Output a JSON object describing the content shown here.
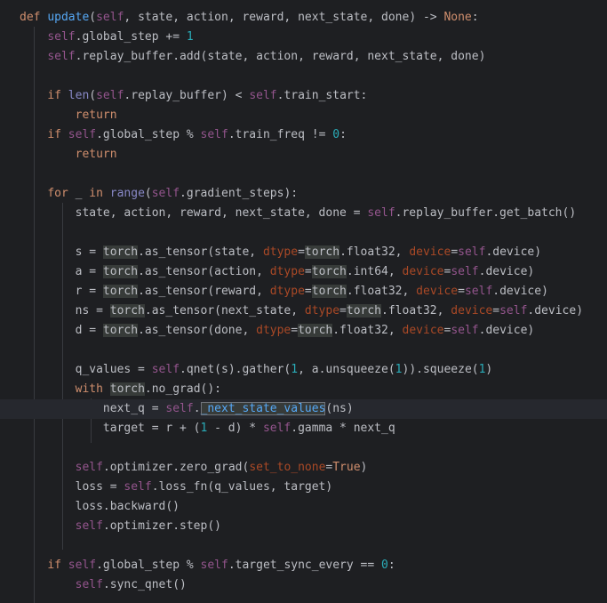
{
  "editor": {
    "language": "python",
    "highlighted_line": 20,
    "lines": [
      [
        [
          "def ",
          "kw"
        ],
        [
          "update",
          "fn"
        ],
        [
          "(",
          "plain"
        ],
        [
          "self",
          "self"
        ],
        [
          ", state, action, reward, next_state, done) -> ",
          "plain"
        ],
        [
          "None",
          "kw"
        ],
        [
          ":",
          "plain"
        ]
      ],
      [
        [
          "    ",
          "plain"
        ],
        [
          "self",
          "self"
        ],
        [
          ".global_step += ",
          "plain"
        ],
        [
          "1",
          "num"
        ]
      ],
      [
        [
          "    ",
          "plain"
        ],
        [
          "self",
          "self"
        ],
        [
          ".replay_buffer.add(state, action, reward, next_state, done)",
          "plain"
        ]
      ],
      [],
      [
        [
          "    ",
          "plain"
        ],
        [
          "if ",
          "kw"
        ],
        [
          "len",
          "builtin"
        ],
        [
          "(",
          "plain"
        ],
        [
          "self",
          "self"
        ],
        [
          ".replay_buffer) < ",
          "plain"
        ],
        [
          "self",
          "self"
        ],
        [
          ".train_start:",
          "plain"
        ]
      ],
      [
        [
          "        ",
          "plain"
        ],
        [
          "return",
          "kw"
        ]
      ],
      [
        [
          "    ",
          "plain"
        ],
        [
          "if ",
          "kw"
        ],
        [
          "self",
          "self"
        ],
        [
          ".global_step % ",
          "plain"
        ],
        [
          "self",
          "self"
        ],
        [
          ".train_freq != ",
          "plain"
        ],
        [
          "0",
          "num"
        ],
        [
          ":",
          "plain"
        ]
      ],
      [
        [
          "        ",
          "plain"
        ],
        [
          "return",
          "kw"
        ]
      ],
      [],
      [
        [
          "    ",
          "plain"
        ],
        [
          "for ",
          "kw"
        ],
        [
          "_ ",
          "plain"
        ],
        [
          "in ",
          "kw"
        ],
        [
          "range",
          "builtin"
        ],
        [
          "(",
          "plain"
        ],
        [
          "self",
          "self"
        ],
        [
          ".gradient_steps):",
          "plain"
        ]
      ],
      [
        [
          "        state, action, reward, next_state, done = ",
          "plain"
        ],
        [
          "self",
          "self"
        ],
        [
          ".replay_buffer.get_batch()",
          "plain"
        ]
      ],
      [],
      [
        [
          "        s = ",
          "plain"
        ],
        [
          "torch",
          "hl"
        ],
        [
          ".as_tensor(state, ",
          "plain"
        ],
        [
          "dtype",
          "param"
        ],
        [
          "=",
          "plain"
        ],
        [
          "torch",
          "hl"
        ],
        [
          ".float32, ",
          "plain"
        ],
        [
          "device",
          "param"
        ],
        [
          "=",
          "plain"
        ],
        [
          "self",
          "self"
        ],
        [
          ".device)",
          "plain"
        ]
      ],
      [
        [
          "        a = ",
          "plain"
        ],
        [
          "torch",
          "hl"
        ],
        [
          ".as_tensor(action, ",
          "plain"
        ],
        [
          "dtype",
          "param"
        ],
        [
          "=",
          "plain"
        ],
        [
          "torch",
          "hl"
        ],
        [
          ".int64, ",
          "plain"
        ],
        [
          "device",
          "param"
        ],
        [
          "=",
          "plain"
        ],
        [
          "self",
          "self"
        ],
        [
          ".device)",
          "plain"
        ]
      ],
      [
        [
          "        r = ",
          "plain"
        ],
        [
          "torch",
          "hl"
        ],
        [
          ".as_tensor(reward, ",
          "plain"
        ],
        [
          "dtype",
          "param"
        ],
        [
          "=",
          "plain"
        ],
        [
          "torch",
          "hl"
        ],
        [
          ".float32, ",
          "plain"
        ],
        [
          "device",
          "param"
        ],
        [
          "=",
          "plain"
        ],
        [
          "self",
          "self"
        ],
        [
          ".device)",
          "plain"
        ]
      ],
      [
        [
          "        ns = ",
          "plain"
        ],
        [
          "torch",
          "hl"
        ],
        [
          ".as_tensor(next_state, ",
          "plain"
        ],
        [
          "dtype",
          "param"
        ],
        [
          "=",
          "plain"
        ],
        [
          "torch",
          "hl"
        ],
        [
          ".float32, ",
          "plain"
        ],
        [
          "device",
          "param"
        ],
        [
          "=",
          "plain"
        ],
        [
          "self",
          "self"
        ],
        [
          ".device)",
          "plain"
        ]
      ],
      [
        [
          "        d = ",
          "plain"
        ],
        [
          "torch",
          "hl"
        ],
        [
          ".as_tensor(done, ",
          "plain"
        ],
        [
          "dtype",
          "param"
        ],
        [
          "=",
          "plain"
        ],
        [
          "torch",
          "hl"
        ],
        [
          ".float32, ",
          "plain"
        ],
        [
          "device",
          "param"
        ],
        [
          "=",
          "plain"
        ],
        [
          "self",
          "self"
        ],
        [
          ".device)",
          "plain"
        ]
      ],
      [],
      [
        [
          "        q_values = ",
          "plain"
        ],
        [
          "self",
          "self"
        ],
        [
          ".qnet(s).gather(",
          "plain"
        ],
        [
          "1",
          "num"
        ],
        [
          ", a.unsqueeze(",
          "plain"
        ],
        [
          "1",
          "num"
        ],
        [
          ")).squeeze(",
          "plain"
        ],
        [
          "1",
          "num"
        ],
        [
          ")",
          "plain"
        ]
      ],
      [
        [
          "        ",
          "plain"
        ],
        [
          "with ",
          "kw"
        ],
        [
          "torch",
          "hl"
        ],
        [
          ".no_grad():",
          "plain"
        ]
      ],
      [
        [
          "            next_q = ",
          "plain"
        ],
        [
          "self",
          "self"
        ],
        [
          ".",
          "plain"
        ],
        [
          "_next_state_values",
          "caret"
        ],
        [
          "(ns)",
          "plain"
        ]
      ],
      [
        [
          "            target = r + (",
          "plain"
        ],
        [
          "1",
          "num"
        ],
        [
          " - d) * ",
          "plain"
        ],
        [
          "self",
          "self"
        ],
        [
          ".gamma * next_q",
          "plain"
        ]
      ],
      [],
      [
        [
          "        ",
          "plain"
        ],
        [
          "self",
          "self"
        ],
        [
          ".optimizer.zero_grad(",
          "plain"
        ],
        [
          "set_to_none",
          "param"
        ],
        [
          "=",
          "plain"
        ],
        [
          "True",
          "kw"
        ],
        [
          ")",
          "plain"
        ]
      ],
      [
        [
          "        loss = ",
          "plain"
        ],
        [
          "self",
          "self"
        ],
        [
          ".loss_fn(q_values, target)",
          "plain"
        ]
      ],
      [
        [
          "        loss.backward()",
          "plain"
        ]
      ],
      [
        [
          "        ",
          "plain"
        ],
        [
          "self",
          "self"
        ],
        [
          ".optimizer.step()",
          "plain"
        ]
      ],
      [],
      [
        [
          "    ",
          "plain"
        ],
        [
          "if ",
          "kw"
        ],
        [
          "self",
          "self"
        ],
        [
          ".global_step % ",
          "plain"
        ],
        [
          "self",
          "self"
        ],
        [
          ".target_sync_every == ",
          "plain"
        ],
        [
          "0",
          "num"
        ],
        [
          ":",
          "plain"
        ]
      ],
      [
        [
          "        ",
          "plain"
        ],
        [
          "self",
          "self"
        ],
        [
          ".sync_qnet()",
          "plain"
        ]
      ]
    ]
  }
}
